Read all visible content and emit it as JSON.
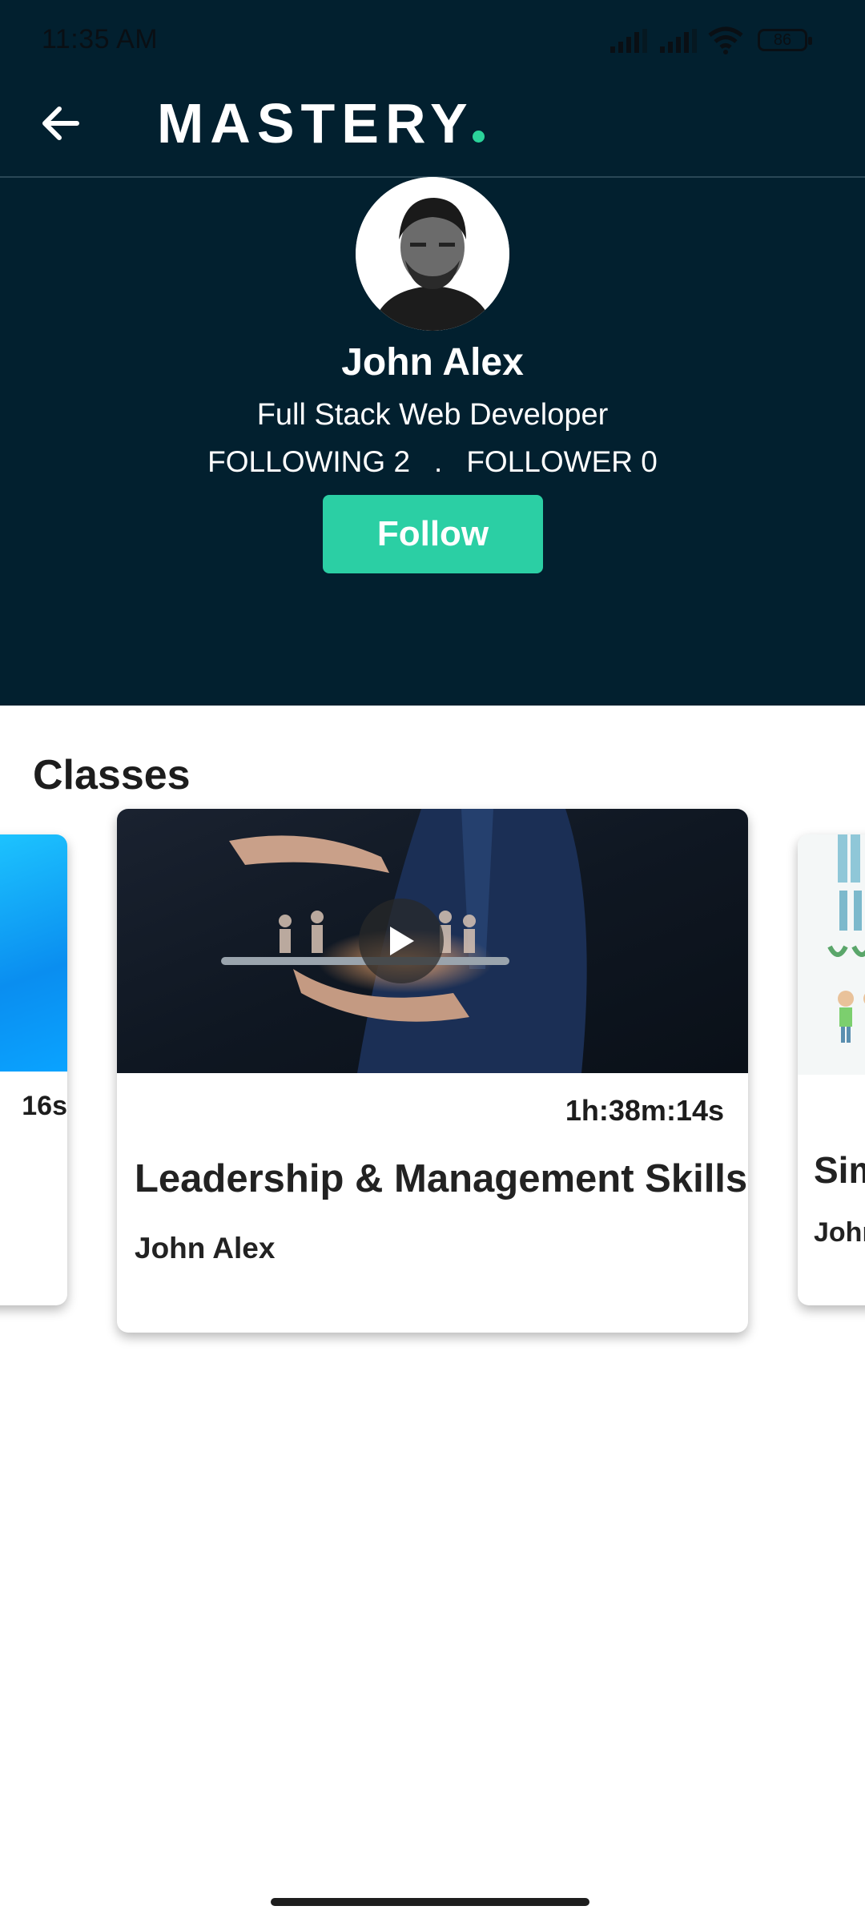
{
  "status_bar": {
    "time": "11:35 AM",
    "battery": "86"
  },
  "app_bar": {
    "logo": "MASTERY",
    "back_icon": "arrow-left-icon"
  },
  "profile": {
    "name": "John Alex",
    "title": "Full Stack Web Developer",
    "following": "FOLLOWING 2",
    "separator": ".",
    "followers": "FOLLOWER 0",
    "follow_label": "Follow"
  },
  "classes": {
    "heading": "Classes",
    "items": [
      {
        "duration": "16s",
        "title": "",
        "author": ""
      },
      {
        "duration": "1h:38m:14s",
        "title": "Leadership & Management Skills",
        "author": "John Alex"
      },
      {
        "duration": "",
        "title": "Sim",
        "author": "John"
      }
    ]
  },
  "colors": {
    "header_bg": "#02202f",
    "accent": "#2bcfa4"
  }
}
